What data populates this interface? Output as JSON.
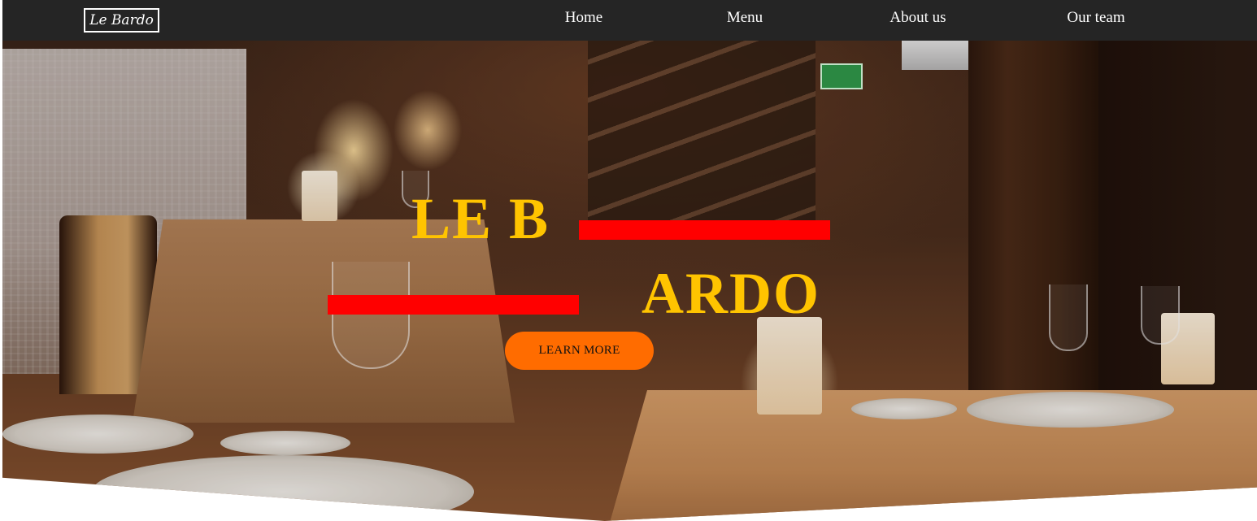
{
  "brand": {
    "logo_text": "Le Bardo"
  },
  "nav": {
    "items": [
      {
        "label": "Home"
      },
      {
        "label": "Menu"
      },
      {
        "label": "About us"
      },
      {
        "label": "Our team"
      }
    ]
  },
  "hero": {
    "title_line_1": "LE B",
    "title_line_2": "ARDO",
    "cta_label": "LEARN MORE",
    "background_image": "restaurant-interior-photo"
  },
  "colors": {
    "navbar_bg": "#252525",
    "title": "#ffc400",
    "accent_bar": "#ff0000",
    "cta_bg": "#ff6c00",
    "nav_text": "#ffffff"
  }
}
